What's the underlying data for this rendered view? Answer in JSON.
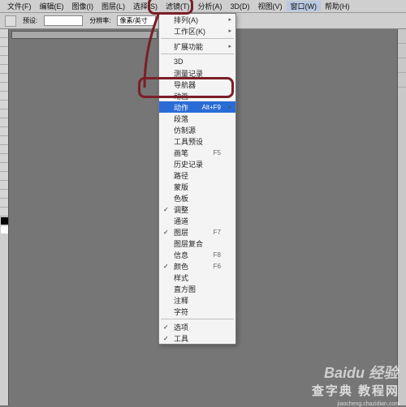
{
  "menubar": {
    "items": [
      "文件(F)",
      "编辑(E)",
      "图像(I)",
      "图层(L)",
      "选择(S)",
      "滤镜(T)",
      "分析(A)",
      "3D(D)",
      "视图(V)",
      "窗口(W)",
      "帮助(H)"
    ],
    "active_index": 9
  },
  "optbar": {
    "label1": "预设:",
    "preset": "",
    "label2": "分辨率:",
    "resolution": "像素/英寸"
  },
  "dropdown": {
    "section1": [
      "排列(A)",
      "工作区(K)"
    ],
    "ext": "扩展功能",
    "items": [
      {
        "label": "3D",
        "chk": false
      },
      {
        "label": "测量记录",
        "chk": false
      },
      {
        "label": "导航器",
        "chk": false
      },
      {
        "label": "动画",
        "chk": false
      }
    ],
    "highlight": {
      "label": "动作",
      "shortcut": "Alt+F9"
    },
    "items2": [
      {
        "label": "段落",
        "chk": false
      },
      {
        "label": "仿制源",
        "chk": false
      },
      {
        "label": "工具预设",
        "chk": false
      },
      {
        "label": "画笔",
        "shortcut": "F5",
        "chk": false
      },
      {
        "label": "历史记录",
        "chk": false
      },
      {
        "label": "路径",
        "chk": false
      },
      {
        "label": "蒙版",
        "chk": false
      },
      {
        "label": "色板",
        "chk": false
      },
      {
        "label": "调整",
        "chk": true
      },
      {
        "label": "通道",
        "chk": false
      },
      {
        "label": "图层",
        "shortcut": "F7",
        "chk": true
      },
      {
        "label": "图层复合",
        "chk": false
      },
      {
        "label": "信息",
        "shortcut": "F8",
        "chk": false
      },
      {
        "label": "颜色",
        "shortcut": "F6",
        "chk": true
      },
      {
        "label": "样式",
        "chk": false
      },
      {
        "label": "直方图",
        "chk": false
      },
      {
        "label": "注释",
        "chk": false
      },
      {
        "label": "字符",
        "chk": false
      }
    ],
    "bottom": [
      {
        "label": "选项",
        "chk": true
      },
      {
        "label": "工具",
        "chk": true
      }
    ]
  },
  "watermark": {
    "brand": "Baidu 经验",
    "site": "查字典 教程网",
    "url": "jiaocheng.chazidian.com"
  }
}
